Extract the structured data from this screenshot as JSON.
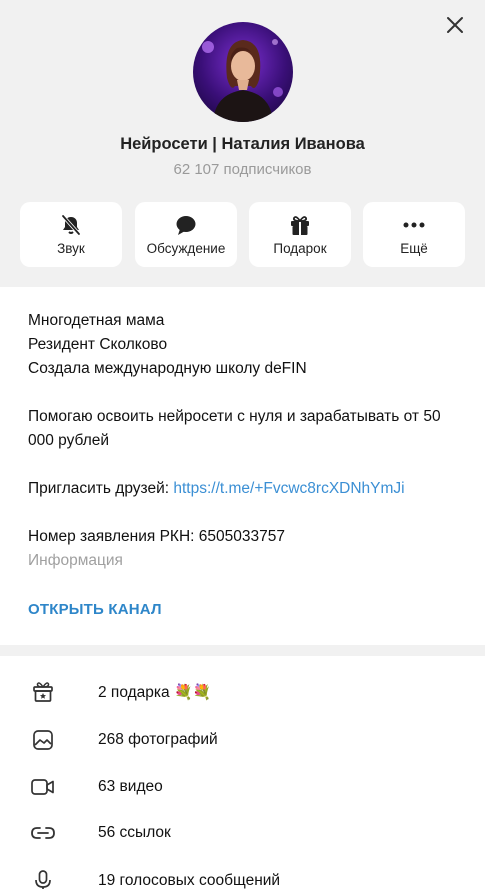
{
  "header": {
    "channel_name": "Нейросети | Наталия Иванова",
    "subscribers": "62 107 подписчиков"
  },
  "actions": [
    {
      "label": "Звук",
      "icon": "bell-off-icon"
    },
    {
      "label": "Обсуждение",
      "icon": "chat-bubble-icon"
    },
    {
      "label": "Подарок",
      "icon": "gift-icon"
    },
    {
      "label": "Ещё",
      "icon": "more-dots-icon"
    }
  ],
  "description": {
    "line1": "Многодетная мама",
    "line2": "Резидент Сколково",
    "line3": "Создала международную школу deFIN",
    "line4": "Помогаю освоить нейросети с нуля и зарабатывать от 50 000 рублей",
    "invite_prefix": "Пригласить друзей: ",
    "invite_link": "https://t.me/+Fvcwc8rcXDNhYmJi",
    "rkn": "Номер заявления РКН: 6505033757",
    "info_label": "Информация"
  },
  "open_channel": "ОТКРЫТЬ КАНАЛ",
  "media": [
    {
      "label": "2 подарка",
      "icon": "gift-star-icon",
      "emoji": "💐💐"
    },
    {
      "label": "268 фотографий",
      "icon": "photo-icon"
    },
    {
      "label": "63 видео",
      "icon": "video-icon"
    },
    {
      "label": "56 ссылок",
      "icon": "link-icon"
    },
    {
      "label": "19 голосовых сообщений",
      "icon": "microphone-icon"
    }
  ]
}
